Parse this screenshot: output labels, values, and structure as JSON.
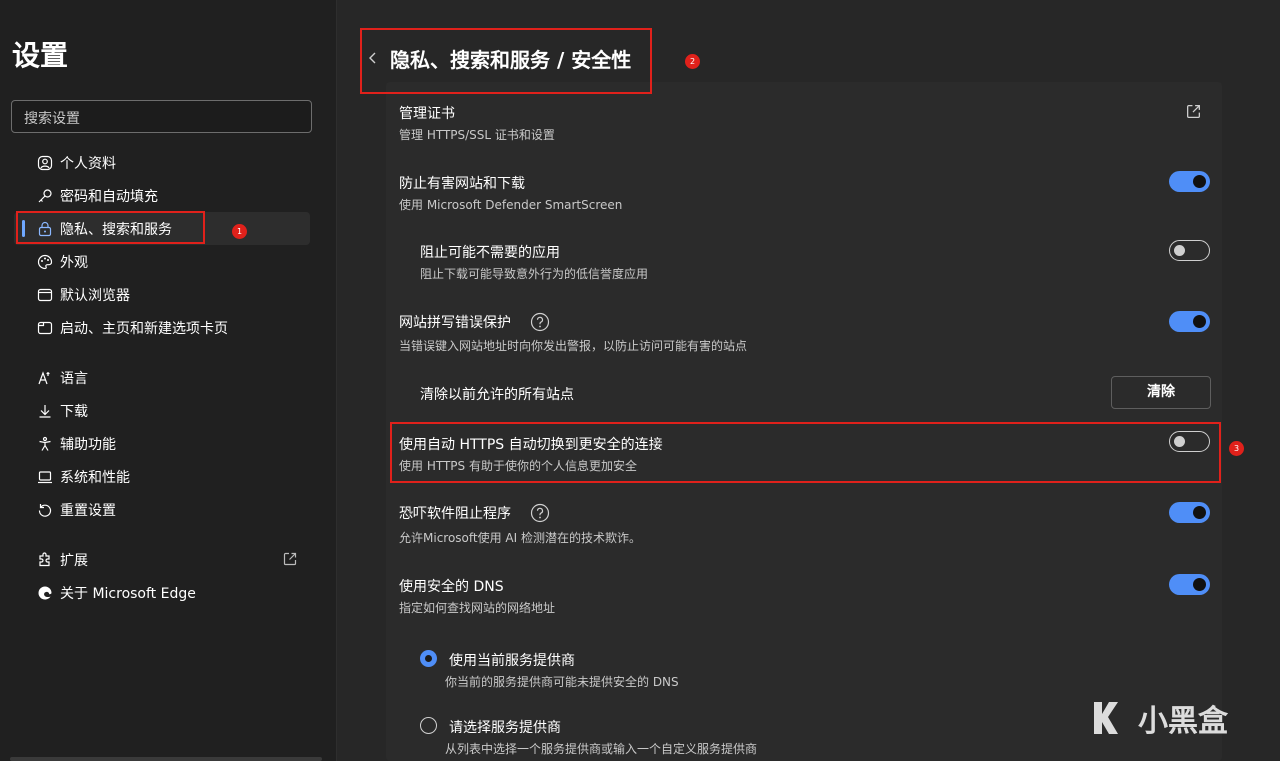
{
  "sidebar": {
    "title": "设置",
    "search_placeholder": "搜索设置",
    "items": [
      {
        "label": "个人资料",
        "icon": "profile-icon"
      },
      {
        "label": "密码和自动填充",
        "icon": "key-icon"
      },
      {
        "label": "隐私、搜索和服务",
        "icon": "lock-icon",
        "active": true
      },
      {
        "label": "外观",
        "icon": "palette-icon"
      },
      {
        "label": "默认浏览器",
        "icon": "browser-icon"
      },
      {
        "label": "启动、主页和新建选项卡页",
        "icon": "power-tab-icon"
      },
      {
        "label": "语言",
        "icon": "language-icon"
      },
      {
        "label": "下载",
        "icon": "download-icon"
      },
      {
        "label": "辅助功能",
        "icon": "accessibility-icon"
      },
      {
        "label": "系统和性能",
        "icon": "laptop-icon"
      },
      {
        "label": "重置设置",
        "icon": "reset-icon"
      },
      {
        "label": "扩展",
        "icon": "extension-icon"
      },
      {
        "label": "关于 Microsoft Edge",
        "icon": "edge-icon"
      }
    ]
  },
  "header": {
    "title": "隐私、搜索和服务 / 安全性"
  },
  "settings": {
    "cert_title": "管理证书",
    "cert_sub": "管理 HTTPS/SSL 证书和设置",
    "smartscreen_title": "防止有害网站和下载",
    "smartscreen_sub": "使用 Microsoft Defender SmartScreen",
    "smartscreen_on": true,
    "pua_title": "阻止可能不需要的应用",
    "pua_sub": "阻止下载可能导致意外行为的低信誉度应用",
    "pua_on": false,
    "typo_title": "网站拼写错误保护",
    "typo_sub": "当错误键入网站地址时向你发出警报，以防止访问可能有害的站点",
    "typo_on": true,
    "clear_title": "清除以前允许的所有站点",
    "clear_button": "清除",
    "https_title": "使用自动 HTTPS 自动切换到更安全的连接",
    "https_sub": "使用 HTTPS 有助于使你的个人信息更加安全",
    "https_on": false,
    "scareware_title": "恐吓软件阻止程序",
    "scareware_sub": "允许Microsoft使用 AI 检测潜在的技术欺诈。",
    "scareware_on": true,
    "dns_title": "使用安全的 DNS",
    "dns_sub": "指定如何查找网站的网络地址",
    "dns_on": true,
    "dns_opt1_title": "使用当前服务提供商",
    "dns_opt1_sub": "你当前的服务提供商可能未提供安全的 DNS",
    "dns_opt2_title": "请选择服务提供商",
    "dns_opt2_sub": "从列表中选择一个服务提供商或输入一个自定义服务提供商"
  },
  "annotations": [
    "1",
    "2",
    "3"
  ],
  "watermark": "小黑盒",
  "colors": {
    "accent": "#4f8ef7",
    "annotation": "#e0211b"
  }
}
